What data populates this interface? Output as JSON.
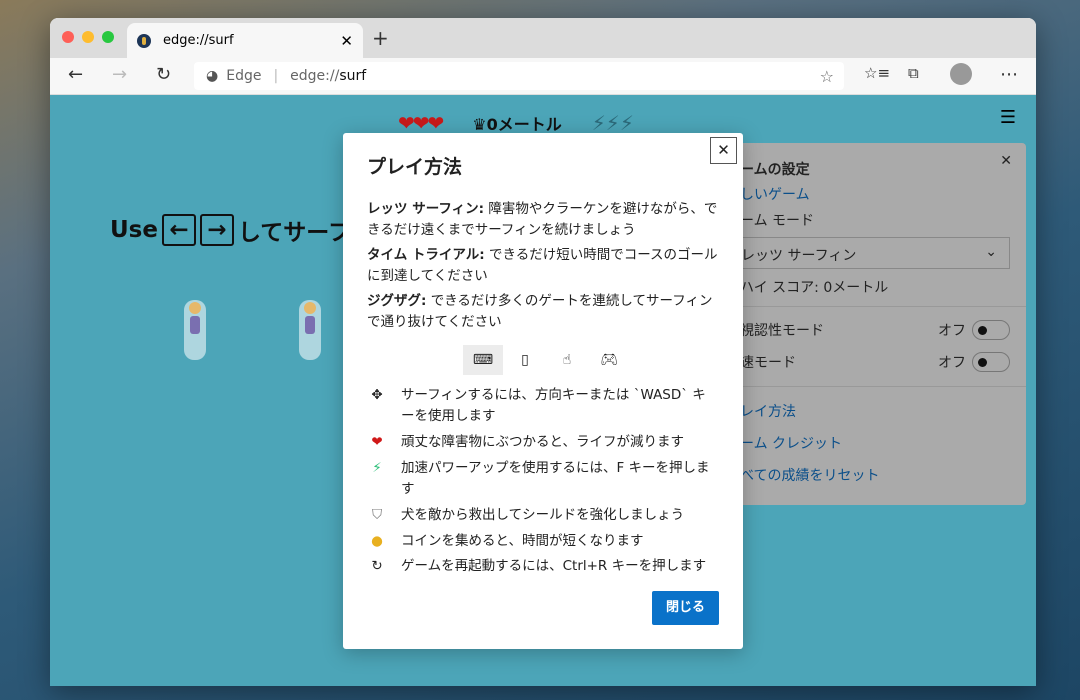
{
  "tab": {
    "title": "edge://surf"
  },
  "toolbar": {
    "site_label": "Edge",
    "url_prefix": "edge://",
    "url_host": "surf"
  },
  "hud": {
    "distance": "0メートル"
  },
  "game": {
    "use_text": "Use",
    "instruction": "してサーフィン"
  },
  "settings": {
    "title": "ームの設定",
    "new_game": "しいゲーム",
    "mode_label": "ーム モード",
    "mode_value": "レッツ サーフィン",
    "high_score": "ハイ スコア: 0メートル",
    "contrast": "視認性モード",
    "contrast_state": "オフ",
    "reduced": "速モード",
    "reduced_state": "オフ",
    "how_to": "レイ方法",
    "credits": "ーム クレジット",
    "reset": "べての成績をリセット"
  },
  "modal": {
    "title": "プレイ方法",
    "modes": [
      {
        "name": "レッツ サーフィン:",
        "text": "障害物やクラーケンを避けながら、できるだけ遠くまでサーフィンを続けましょう"
      },
      {
        "name": "タイム トライアル:",
        "text": "できるだけ短い時間でコースのゴールに到達してください"
      },
      {
        "name": "ジグザグ:",
        "text": "できるだけ多くのゲートを連続してサーフィンで通り抜けてください"
      }
    ],
    "tips": [
      "サーフィンするには、方向キーまたは `WASD` キーを使用します",
      "頑丈な障害物にぶつかると、ライフが減ります",
      "加速パワーアップを使用するには、F キーを押します",
      "犬を敵から救出してシールドを強化しましょう",
      "コインを集めると、時間が短くなります",
      "ゲームを再起動するには、Ctrl+R キーを押します"
    ],
    "close": "閉じる"
  }
}
